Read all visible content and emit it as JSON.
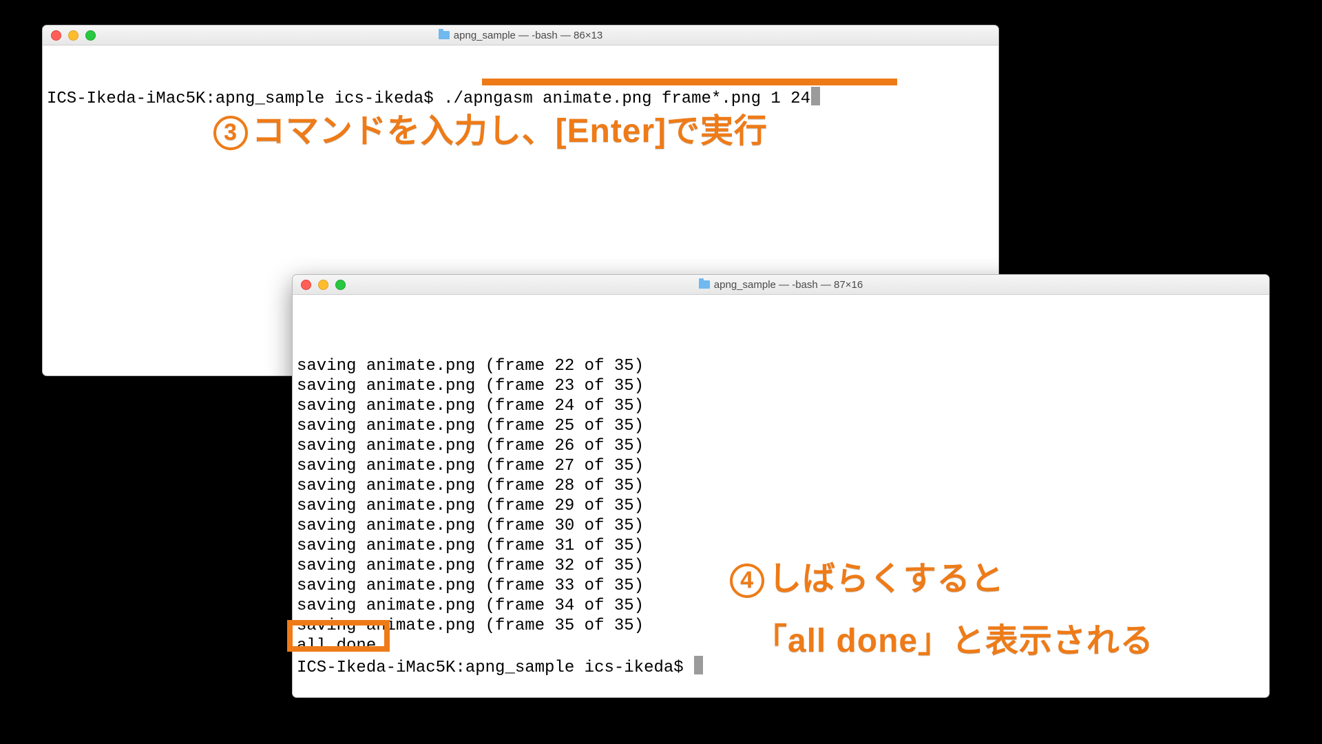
{
  "window1": {
    "title": "apng_sample — -bash — 86×13",
    "prompt": "ICS-Ikeda-iMac5K:apng_sample ics-ikeda$ ",
    "command": "./apngasm animate.png frame*.png 1 24"
  },
  "window2": {
    "title": "apng_sample — -bash — 87×16",
    "output_lines": [
      "saving animate.png (frame 22 of 35)",
      "saving animate.png (frame 23 of 35)",
      "saving animate.png (frame 24 of 35)",
      "saving animate.png (frame 25 of 35)",
      "saving animate.png (frame 26 of 35)",
      "saving animate.png (frame 27 of 35)",
      "saving animate.png (frame 28 of 35)",
      "saving animate.png (frame 29 of 35)",
      "saving animate.png (frame 30 of 35)",
      "saving animate.png (frame 31 of 35)",
      "saving animate.png (frame 32 of 35)",
      "saving animate.png (frame 33 of 35)",
      "saving animate.png (frame 34 of 35)",
      "saving animate.png (frame 35 of 35)",
      "all done"
    ],
    "prompt": "ICS-Ikeda-iMac5K:apng_sample ics-ikeda$ "
  },
  "annotations": {
    "step3_num": "3",
    "step3_text": "コマンドを入力し、[Enter]で実行",
    "step4_num": "4",
    "step4_line1": "しばらくすると",
    "step4_line2": "「all done」と表示される"
  },
  "colors": {
    "accent": "#ee7b18"
  }
}
